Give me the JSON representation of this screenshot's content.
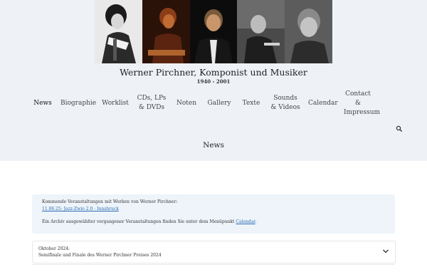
{
  "site": {
    "title": "Werner Pirchner, Komponist und Musiker",
    "years": "1940 - 2001"
  },
  "nav": {
    "items": [
      {
        "label": "News"
      },
      {
        "label": "Biographie"
      },
      {
        "label": "Worklist"
      },
      {
        "label": "CDs, LPs & DVDs"
      },
      {
        "label": "Noten"
      },
      {
        "label": "Gallery"
      },
      {
        "label": "Texte"
      },
      {
        "label": "Sounds & Videos"
      },
      {
        "label": "Calendar"
      },
      {
        "label": "Contact & Impressum"
      }
    ],
    "active": "News",
    "search_icon": "search-icon"
  },
  "page": {
    "heading": "News"
  },
  "info": {
    "upcoming_label": "Kommende Veranstaltungen mit Werken von Werner Pirchner:",
    "event_link": "11.06.25: Jazz-Zwio 2.0 - Innsbruck",
    "archive_text_before": "Ein Archiv ausgewählter vergangener Veranstaltungen finden Sie unter dem Menüpunkt ",
    "archive_link": "Calendar",
    "archive_text_after": "."
  },
  "accordion": [
    {
      "month": "Oktober 2024:",
      "title": "Semifinale und Finale des Werner Pirchner Preises 2024",
      "icon": "chevron-down-icon"
    }
  ],
  "colors": {
    "header_bg": "#eef2f7",
    "info_bg": "#eef4fa",
    "link": "#2a6cb0"
  }
}
